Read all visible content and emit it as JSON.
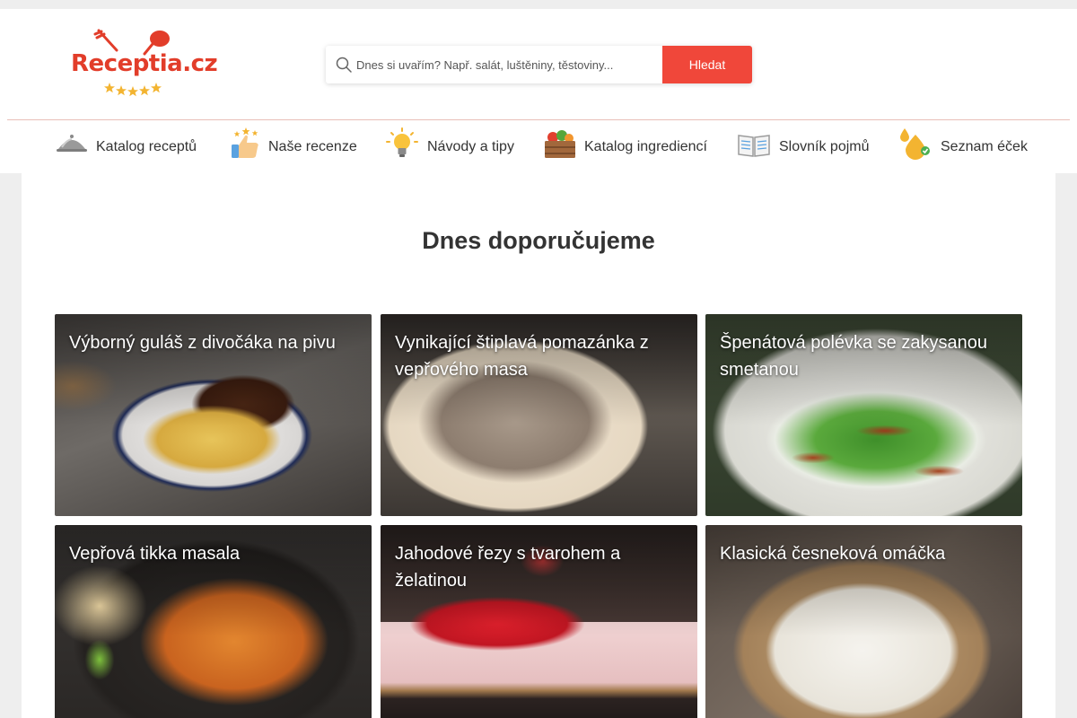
{
  "brand": {
    "logo_text": "Receptia.cz",
    "color": "#e23d2a"
  },
  "search": {
    "placeholder": "Dnes si uvařím? Např. salát, luštěniny, těstoviny...",
    "button_label": "Hledat",
    "button_color": "#f0473a"
  },
  "nav": {
    "items": [
      {
        "label": "Katalog receptů",
        "icon": "cloche-icon"
      },
      {
        "label": "Naše recenze",
        "icon": "thumbs-up-icon"
      },
      {
        "label": "Návody a tipy",
        "icon": "lightbulb-icon"
      },
      {
        "label": "Katalog ingrediencí",
        "icon": "vegetable-crate-icon"
      },
      {
        "label": "Slovník pojmů",
        "icon": "open-book-icon"
      },
      {
        "label": "Seznam éček",
        "icon": "e-numbers-icon"
      }
    ]
  },
  "main": {
    "section_title": "Dnes doporučujeme",
    "recipes": [
      {
        "title": "Výborný guláš z divočáka na pivu",
        "image": "goulash-photo"
      },
      {
        "title": "Vynikající štiplavá pomazánka z vepřového masa",
        "image": "pork-spread-photo"
      },
      {
        "title": "Špenátová polévka se zakysanou smetanou",
        "image": "spinach-soup-photo"
      },
      {
        "title": "Vepřová tikka masala",
        "image": "tikka-masala-photo"
      },
      {
        "title": "Jahodové řezy s tvarohem a želatinou",
        "image": "strawberry-cake-photo"
      },
      {
        "title": "Klasická česneková omáčka",
        "image": "garlic-sauce-photo"
      }
    ]
  }
}
